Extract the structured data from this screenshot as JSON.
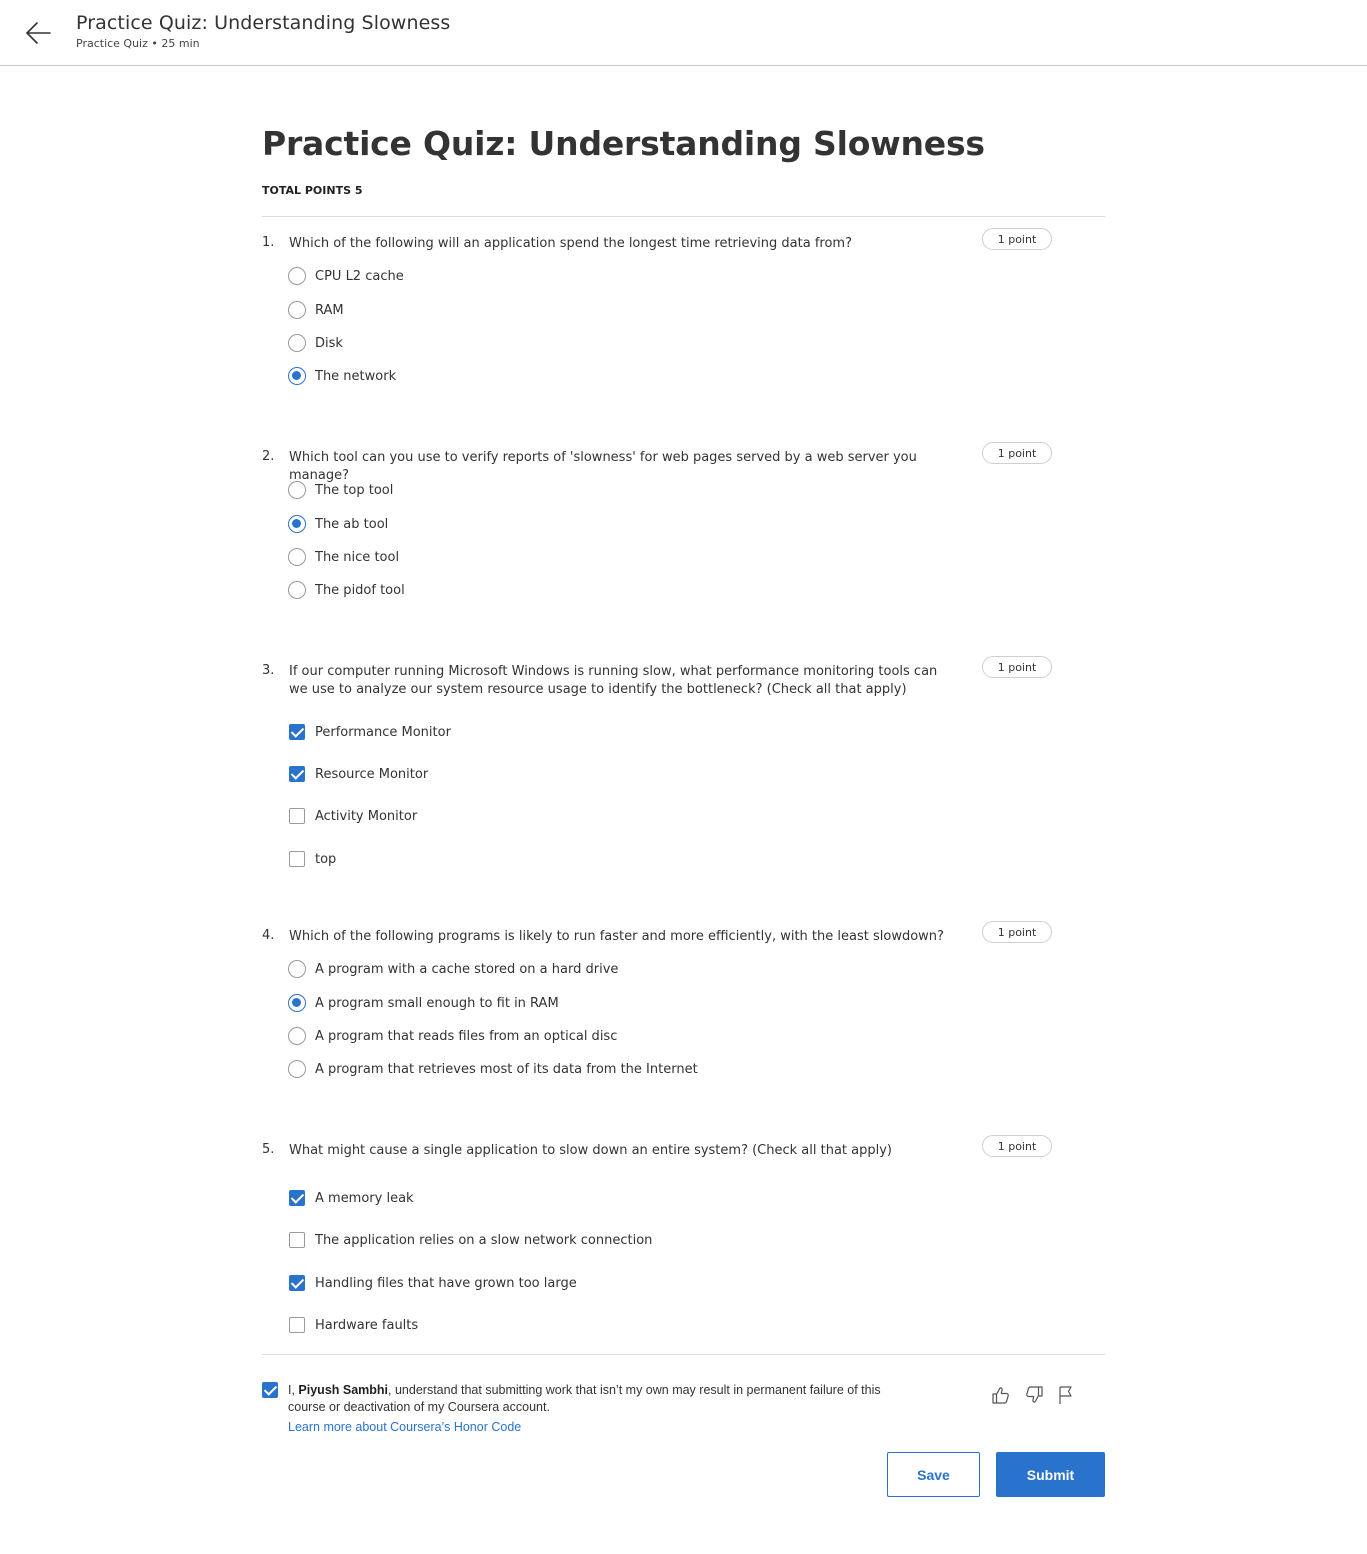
{
  "header": {
    "title": "Practice Quiz: Understanding Slowness",
    "subtitle": "Practice Quiz • 25 min"
  },
  "page": {
    "title": "Practice Quiz: Understanding Slowness",
    "total_points": "TOTAL POINTS 5"
  },
  "questions": [
    {
      "number": "1.",
      "text": "Which of the following will an application spend the longest time retrieving data from?",
      "points": "1 point",
      "type": "radio",
      "options": [
        {
          "label": "CPU L2 cache",
          "checked": false
        },
        {
          "label": "RAM",
          "checked": false
        },
        {
          "label": "Disk",
          "checked": false
        },
        {
          "label": "The network",
          "checked": true
        }
      ]
    },
    {
      "number": "2.",
      "text": "Which tool can you use to verify reports of 'slowness' for web pages served by a web server you manage?",
      "points": "1 point",
      "type": "radio",
      "options": [
        {
          "label": "The top tool",
          "checked": false
        },
        {
          "label": "The ab tool",
          "checked": true
        },
        {
          "label": "The nice tool",
          "checked": false
        },
        {
          "label": "The pidof tool",
          "checked": false
        }
      ]
    },
    {
      "number": "3.",
      "text": "If our computer running Microsoft Windows is running slow, what performance monitoring tools can we use to analyze our system resource usage to identify the bottleneck? (Check all that apply)",
      "points": "1 point",
      "type": "checkbox",
      "options": [
        {
          "label": "Performance Monitor",
          "checked": true
        },
        {
          "label": "Resource Monitor",
          "checked": true
        },
        {
          "label": "Activity Monitor",
          "checked": false
        },
        {
          "label": "top",
          "checked": false
        }
      ]
    },
    {
      "number": "4.",
      "text": "Which of the following programs is likely to run faster and more efficiently, with the least slowdown?",
      "points": "1 point",
      "type": "radio",
      "options": [
        {
          "label": "A program with a cache stored on a hard drive",
          "checked": false
        },
        {
          "label": "A program small enough to fit in RAM",
          "checked": true
        },
        {
          "label": "A program that reads files from an optical disc",
          "checked": false
        },
        {
          "label": "A program that retrieves most of its data from the Internet",
          "checked": false
        }
      ]
    },
    {
      "number": "5.",
      "text": "What might cause a single application to slow down an entire system? (Check all that apply)",
      "points": "1 point",
      "type": "checkbox",
      "options": [
        {
          "label": "A memory leak",
          "checked": true
        },
        {
          "label": "The application relies on a slow network connection",
          "checked": false
        },
        {
          "label": "Handling files that have grown too large",
          "checked": true
        },
        {
          "label": "Hardware faults",
          "checked": false
        }
      ]
    }
  ],
  "honor": {
    "checked": true,
    "prefix": "I, ",
    "name": "Piyush Sambhi",
    "suffix": ", understand that submitting work that isn’t my own may result in permanent failure of this course or deactivation of my Coursera account.",
    "link": "Learn more about Coursera’s Honor Code"
  },
  "feedback_icons": [
    "thumbs-up-icon",
    "thumbs-down-icon",
    "flag-icon"
  ],
  "buttons": {
    "save": "Save",
    "submit": "Submit"
  },
  "colors": {
    "accent": "#2a73cc"
  }
}
